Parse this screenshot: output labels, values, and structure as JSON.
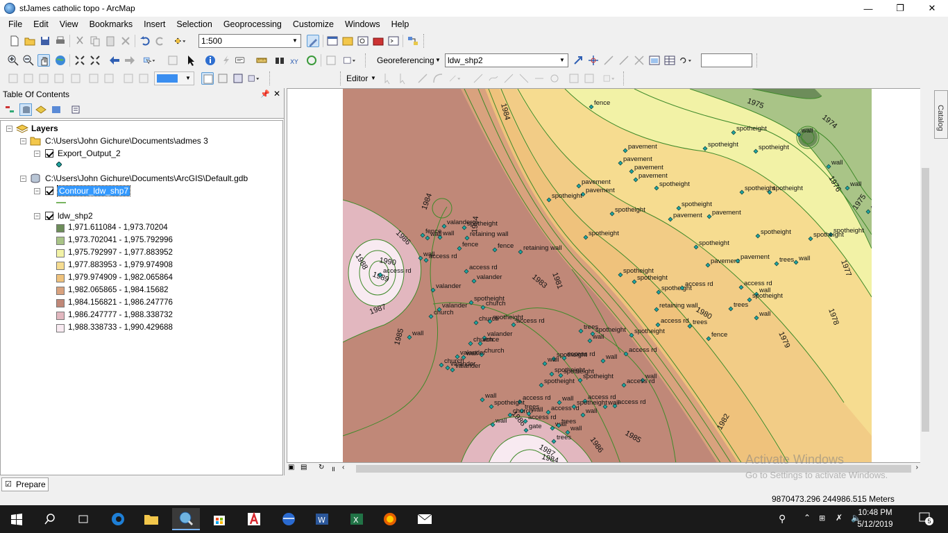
{
  "window": {
    "title": "stJames catholic topo - ArcMap"
  },
  "menu": [
    "File",
    "Edit",
    "View",
    "Bookmarks",
    "Insert",
    "Selection",
    "Geoprocessing",
    "Customize",
    "Windows",
    "Help"
  ],
  "toolbar": {
    "scale": "1:500",
    "georeferencing_label": "Georeferencing",
    "layer_select": "ldw_shp2",
    "editor_label": "Editor"
  },
  "toc": {
    "title": "Table Of Contents",
    "root": "Layers",
    "group1_path": "C:\\Users\\John Gichure\\Documents\\admes 3",
    "layer_export": "Export_Output_2",
    "group2_path": "C:\\Users\\John Gichure\\Documents\\ArcGIS\\Default.gdb",
    "layer_contour": "Contour_ldw_shp7",
    "layer_raster": "ldw_shp2",
    "legend": [
      {
        "range": "1,971.611084 - 1,973.70204",
        "color": "#6d8d5a"
      },
      {
        "range": "1,973.702041 - 1,975.792996",
        "color": "#a9c487"
      },
      {
        "range": "1,975.792997 - 1,977.883952",
        "color": "#f2f2a6"
      },
      {
        "range": "1,977.883953 - 1,979.974908",
        "color": "#f6dc90"
      },
      {
        "range": "1,979.974909 - 1,982.065864",
        "color": "#efc27c"
      },
      {
        "range": "1,982.065865 - 1,984.15682",
        "color": "#d9a27e"
      },
      {
        "range": "1,984.156821 - 1,986.247776",
        "color": "#c08878"
      },
      {
        "range": "1,986.247777 - 1,988.338732",
        "color": "#e2b7bf"
      },
      {
        "range": "1,988.338733 - 1,990.429688",
        "color": "#f8eaf1"
      }
    ]
  },
  "map": {
    "contour_labels": [
      "1975",
      "1974",
      "1976",
      "1975",
      "1977",
      "1978",
      "1979",
      "1980",
      "1981",
      "1982",
      "1983",
      "1984",
      "1984",
      "1985",
      "1985",
      "1986",
      "1986",
      "1987",
      "1987",
      "1988",
      "1989",
      "1990",
      "1984",
      "1986",
      "1987",
      "1984"
    ],
    "feature_labels": [
      "fence",
      "spotheight",
      "spotheight",
      "spotheight",
      "wall",
      "wall",
      "wall",
      "wall",
      "pavement",
      "pavement",
      "pavement",
      "pavement",
      "pavement",
      "pavement",
      "spotheight",
      "spotheight",
      "spotheight",
      "spotheight",
      "spotheight",
      "spotheight",
      "spotheight",
      "pavement",
      "pavement",
      "spotheight",
      "spotheight",
      "spotheight",
      "spotheight",
      "spotheight",
      "retaining wall",
      "fence",
      "pavement",
      "pavement",
      "trees",
      "wall",
      "spotheight",
      "spotheight",
      "access rd",
      "access rd",
      "wall",
      "spotheight",
      "trees",
      "wall",
      "spotheight",
      "spotheight",
      "access rd",
      "retaining wall",
      "trees",
      "access rd",
      "spotheight",
      "access rd",
      "spotheight",
      "wall",
      "wall",
      "fence",
      "wall",
      "church",
      "valander",
      "spotheight",
      "valander",
      "valander",
      "church",
      "church",
      "spotheight",
      "fence",
      "valander",
      "church",
      "church",
      "valander",
      "church",
      "valander",
      "wall",
      "valander",
      "valander",
      "wall",
      "spotheight",
      "retaining wall",
      "fence",
      "access rd",
      "access rd",
      "trees",
      "wall",
      "spotheight",
      "access rd",
      "access rd",
      "access rd",
      "wall",
      "spotheight",
      "spotheight",
      "access rd",
      "wall",
      "access rd",
      "trees",
      "wall",
      "wall",
      "wall",
      "gate",
      "wall",
      "trees",
      "trees",
      "wall",
      "spotheight",
      "access rd",
      "spotheight",
      "wall",
      "fence",
      "church",
      "wall",
      "wall",
      "access rd",
      "access rd",
      "wall"
    ]
  },
  "status": {
    "coords": "9870473.296  244986.515 Meters"
  },
  "watermark": {
    "line1": "Activate Windows",
    "line2": "Go to Settings to activate Windows."
  },
  "prepare_tab": "Prepare",
  "catalog_tab": "Catalog",
  "clock": {
    "time": "10:48 PM",
    "date": "5/12/2019"
  },
  "notifications": "5"
}
